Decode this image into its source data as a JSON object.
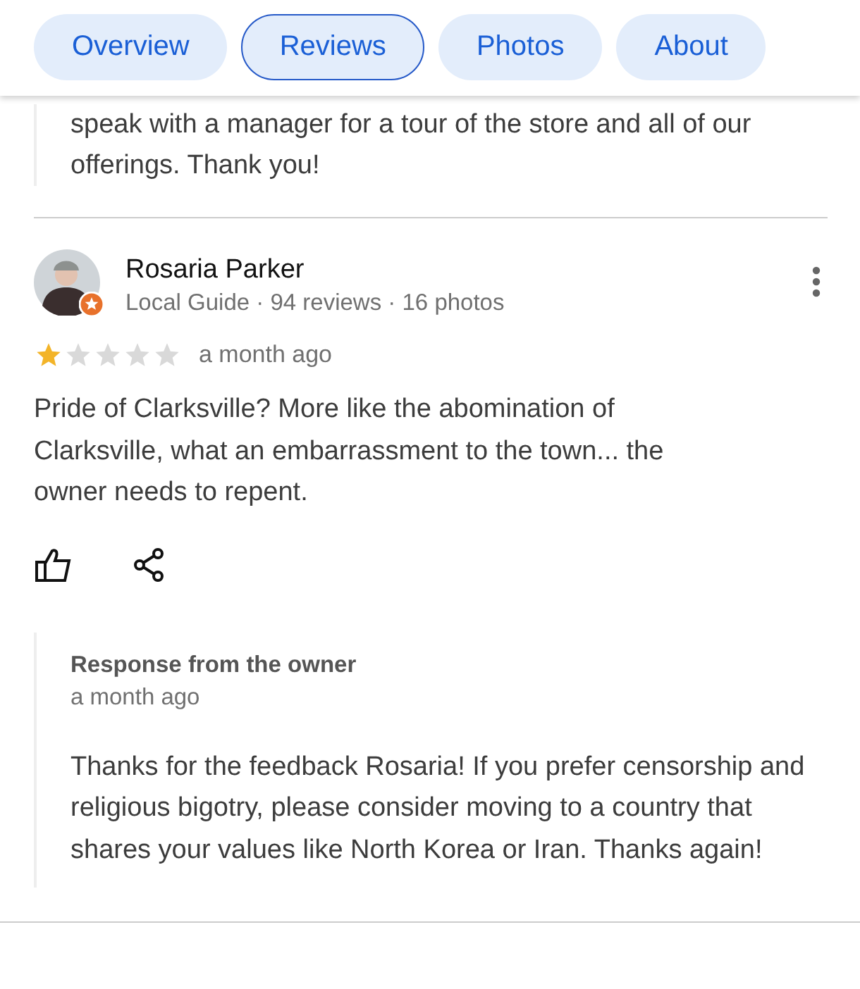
{
  "tabs": [
    {
      "label": "Overview",
      "selected": false
    },
    {
      "label": "Reviews",
      "selected": true
    },
    {
      "label": "Photos",
      "selected": false
    },
    {
      "label": "About",
      "selected": false
    }
  ],
  "previous_response": {
    "lines": [
      "speak with a manager for a tour of the store and all of our",
      "offerings. Thank you!"
    ]
  },
  "review": {
    "author": "Rosaria Parker",
    "meta": "Local Guide · 94 reviews · 16 photos",
    "stars": 1,
    "time": "a month ago",
    "text": "Pride of Clarksville? More like the abomination of Clarksville, what an embarrassment to the town... the owner needs to repent.",
    "owner_response": {
      "title": "Response from the owner",
      "time": "a month ago",
      "text": "Thanks for the feedback Rosaria! If you prefer censorship and religious bigotry, please consider moving to a country that shares your values like North Korea or Iran. Thanks again!"
    }
  }
}
